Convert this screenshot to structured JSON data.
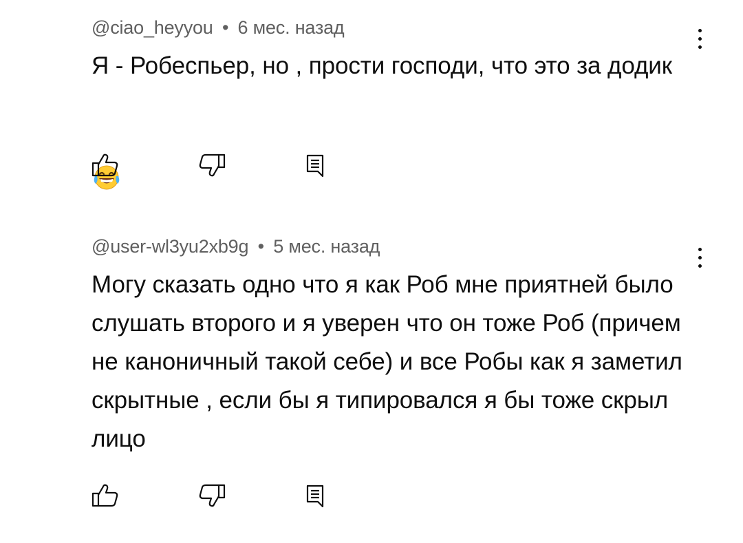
{
  "comments": [
    {
      "author": "@ciao_heyyou",
      "separator": "•",
      "time": "6 мес. назад",
      "text": "Я - Робеспьер, но , прости господи, что это за додик",
      "emoji": "face-with-tears-of-joy"
    },
    {
      "author": "@user-wl3yu2xb9g",
      "separator": "•",
      "time": "5 мес. назад",
      "text": "Могу сказать одно что я как Роб мне приятней было слушать второго и я уверен что он тоже Роб (причем не каноничный такой себе) и все Робы как я заметил скрытные , если бы я типировался я бы тоже скрыл лицо"
    }
  ],
  "icons": {
    "like": "thumb-up-icon",
    "dislike": "thumb-down-icon",
    "reply": "reply-icon",
    "more": "more-vert-icon"
  },
  "colors": {
    "text": "#0f0f0f",
    "meta": "#606060",
    "background": "#ffffff",
    "emoji_face": "#FFCC33"
  }
}
